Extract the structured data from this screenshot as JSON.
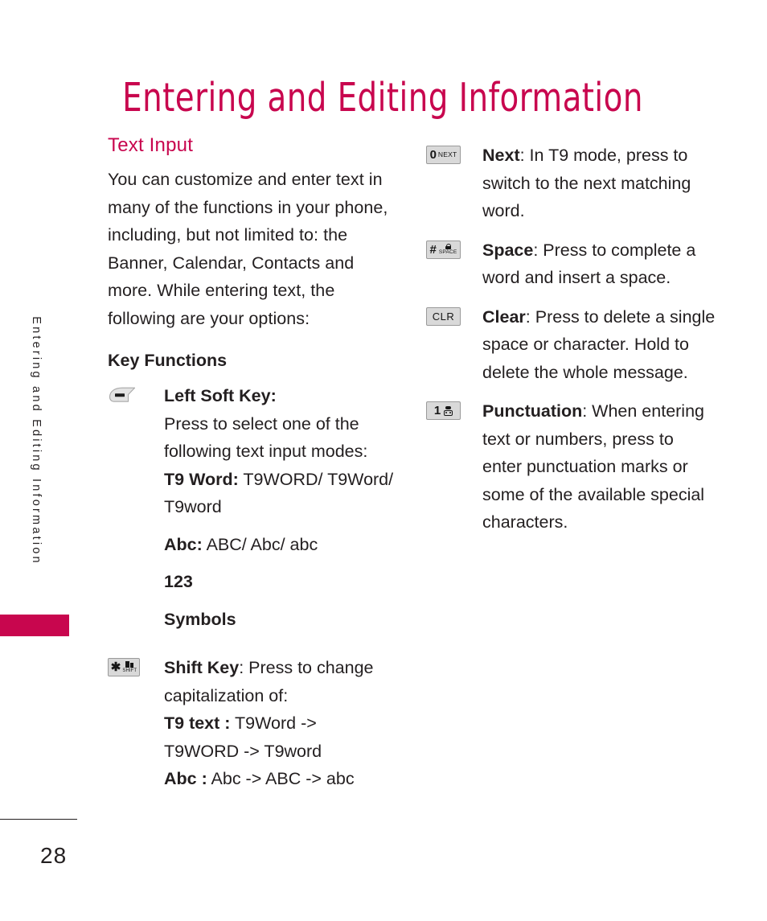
{
  "page": {
    "title": "Entering and Editing Information",
    "number": "28",
    "accent_color": "#C8064E",
    "text_color": "#231f20",
    "side_tab_label": "Entering and Editing Information"
  },
  "left_column": {
    "section_title": "Text Input",
    "intro_paragraph": "You can customize and enter text in many of the functions in your phone, including, but not limited to: the Banner, Calendar, Contacts and more. While entering text, the following are your options:",
    "sub_heading": "Key Functions",
    "entries": [
      {
        "icon": "left-soft-key-icon",
        "label": "Left Soft Key",
        "label_suffix": ":",
        "description": "Press to select one of the following text input modes:",
        "modes": [
          {
            "bold": "T9 Word:",
            "rest": " T9WORD/ T9Word/ T9word"
          },
          {
            "bold": "Abc:",
            "rest": " ABC/ Abc/ abc"
          },
          {
            "bold": "123",
            "rest": ""
          },
          {
            "bold": "Symbols",
            "rest": ""
          }
        ]
      },
      {
        "icon": "shift-key-icon",
        "icon_glyph": "✱",
        "icon_caption": "SHIFT",
        "label": "Shift Key",
        "label_suffix": ": Press to change capitalization of:",
        "modes": [
          {
            "bold": "T9 text :",
            "rest": " T9Word -> T9WORD -> T9word"
          },
          {
            "bold": "Abc :",
            "rest": " Abc -> ABC -> abc"
          }
        ]
      }
    ]
  },
  "right_column": {
    "entries": [
      {
        "icon": "key-0-next-icon",
        "icon_digit": "0",
        "icon_caption": "NEXT",
        "label": "Next",
        "description": ": In T9 mode, press to switch to the next matching word."
      },
      {
        "icon": "key-hash-space-icon",
        "icon_digit": "#",
        "icon_caption": "SPACE",
        "label": "Space",
        "description": ": Press to complete a word and insert a space."
      },
      {
        "icon": "key-clr-icon",
        "icon_digit": "CLR",
        "icon_caption": "",
        "label": "Clear",
        "description": ": Press to delete a single space or character. Hold to delete the whole message."
      },
      {
        "icon": "key-1-punctuation-icon",
        "icon_digit": "1",
        "icon_caption": "",
        "label": "Punctuation",
        "description": ": When entering text or numbers, press to enter punctuation marks or some of the available special characters."
      }
    ]
  }
}
